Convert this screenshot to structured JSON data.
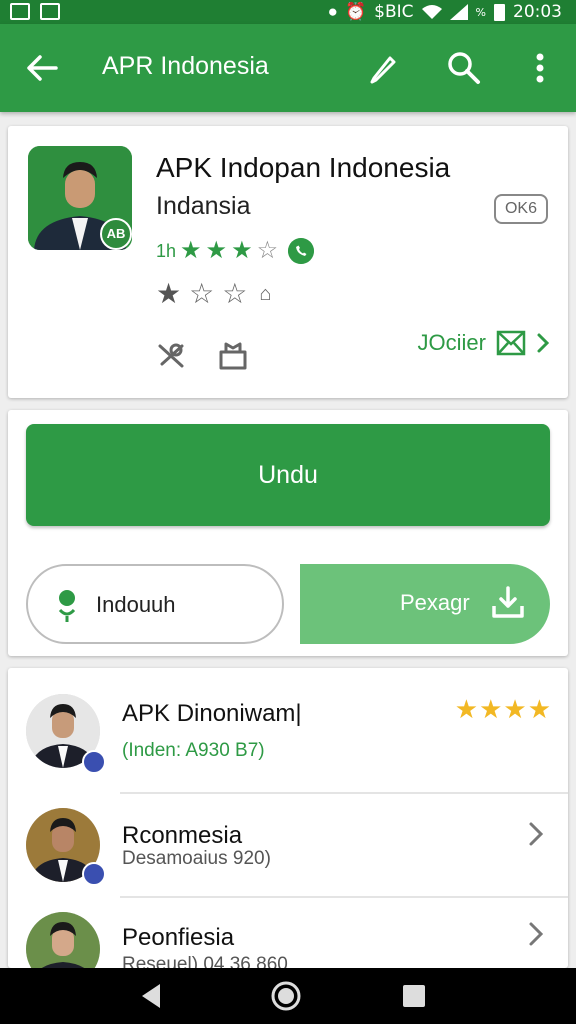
{
  "status_bar": {
    "time": "20:03",
    "misc": "$BIC",
    "signal_percent": "%"
  },
  "app_bar": {
    "title": "APR Indonesia"
  },
  "app_card": {
    "icon_badge": "AB",
    "title": "APK Indopan Indonesia",
    "subtitle": "Indansia",
    "size_chip": "OK6",
    "rating_prefix": "1h",
    "rating_line_1_stars": 3,
    "rating_line_2_stars": 1,
    "join_label": "JOciier"
  },
  "actions": {
    "primary_label": "Undu",
    "outline_label": "Indouuh",
    "secondary_label": "Pexagr"
  },
  "list": [
    {
      "title": "APK Dinoniwam|",
      "subtitle": "(Inden: A930 B7)",
      "stars": "★★★★"
    },
    {
      "title": "Rconmesia",
      "subtitle": "Desamoaius 920)"
    },
    {
      "title": "Peonfiesia",
      "subtitle": "Reseuel) 04 36 860"
    }
  ],
  "colors": {
    "primary": "#2e9a45",
    "status_bar": "#1f7f33",
    "star": "#f2b824"
  }
}
